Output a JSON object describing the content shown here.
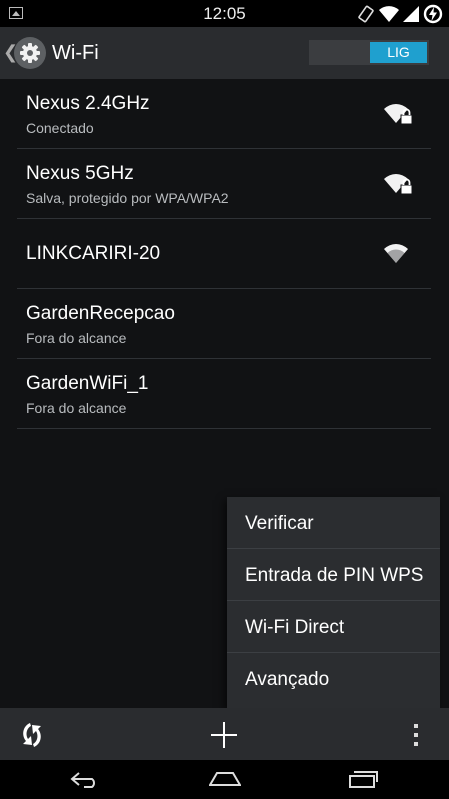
{
  "status_bar": {
    "time": "12:05"
  },
  "header": {
    "title": "Wi-Fi",
    "toggle_label": "LIG"
  },
  "networks": [
    {
      "name": "Nexus 2.4GHz",
      "status": "Conectado",
      "secured": true
    },
    {
      "name": "Nexus 5GHz",
      "status": "Salva, protegido por WPA/WPA2",
      "secured": true
    },
    {
      "name": "LINKCARIRI-20",
      "status": "",
      "secured": false
    },
    {
      "name": "GardenRecepcao",
      "status": "Fora do alcance",
      "secured": false
    },
    {
      "name": "GardenWiFi_1",
      "status": "Fora do alcance",
      "secured": false
    }
  ],
  "overflow_menu": [
    {
      "label": "Verificar"
    },
    {
      "label": "Entrada de PIN WPS"
    },
    {
      "label": "Wi-Fi Direct"
    },
    {
      "label": "Avançado"
    }
  ],
  "colors": {
    "accent": "#1fa0cf",
    "background": "#111214",
    "bar": "#2a2c2f"
  },
  "icons": [
    "gallery-icon",
    "rotate-icon",
    "wifi-icon",
    "signal-icon",
    "battery-charging-icon",
    "back-chevron-icon",
    "gear-icon",
    "wifi-lock-icon",
    "wifi-icon",
    "wps-icon",
    "add-icon",
    "overflow-icon",
    "back-icon",
    "home-icon",
    "recents-icon"
  ]
}
